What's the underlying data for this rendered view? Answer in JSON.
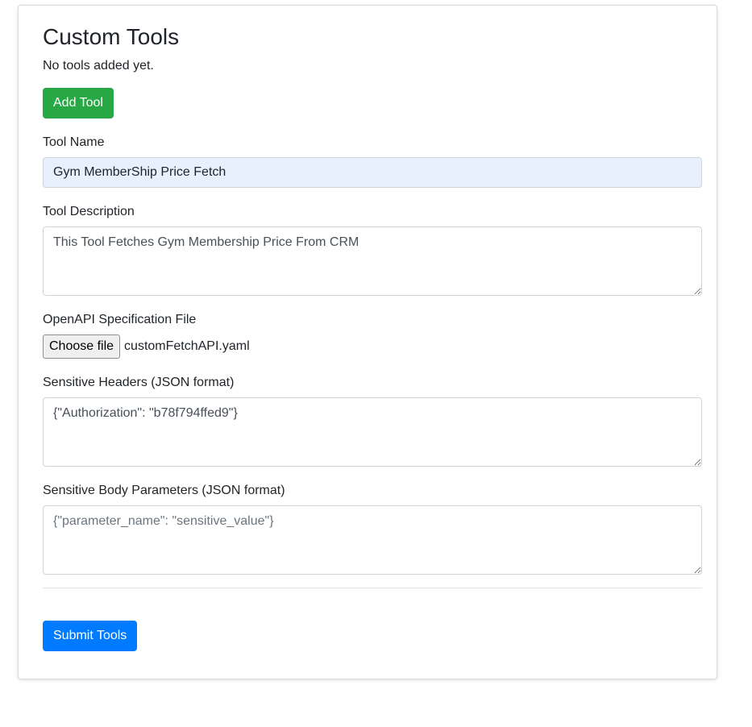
{
  "card": {
    "title": "Custom Tools",
    "empty_message": "No tools added yet.",
    "add_tool_label": "Add Tool"
  },
  "form": {
    "tool_name": {
      "label": "Tool Name",
      "value": "Gym MemberShip Price Fetch"
    },
    "tool_description": {
      "label": "Tool Description",
      "value": "This Tool Fetches Gym Membership Price From CRM"
    },
    "openapi_file": {
      "label": "OpenAPI Specification File",
      "button_label": "Choose file",
      "file_name": "customFetchAPI.yaml"
    },
    "sensitive_headers": {
      "label": "Sensitive Headers (JSON format)",
      "value": "{\"Authorization\": \"b78f794ffed9\"}"
    },
    "sensitive_body": {
      "label": "Sensitive Body Parameters (JSON format)",
      "value": "",
      "placeholder": "{\"parameter_name\": \"sensitive_value\"}"
    }
  },
  "submit_label": "Submit Tools",
  "colors": {
    "add_button": "#28a745",
    "submit_button": "#007bff",
    "autofill_background": "#e8f0fe"
  }
}
